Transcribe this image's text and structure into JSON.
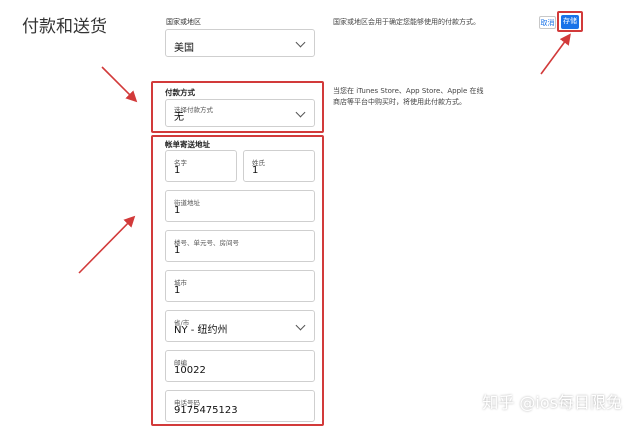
{
  "page": {
    "title": "付款和送货"
  },
  "region": {
    "label": "国家或地区",
    "value": "美国",
    "description": "国家或地区会用于确定您能够使用的付款方式。"
  },
  "payment": {
    "section_label": "付款方式",
    "select_caption": "选择付款方式",
    "select_value": "无",
    "description": "当您在 iTunes Store、App Store、Apple 在线商店等平台中购买时，将使用此付款方式。"
  },
  "billing": {
    "section_label": "帐单寄送地址",
    "first_name": {
      "caption": "名字",
      "value": "1"
    },
    "last_name": {
      "caption": "姓氏",
      "value": "1"
    },
    "street": {
      "caption": "街道地址",
      "value": "1"
    },
    "unit": {
      "caption": "楼号、单元号、房间号",
      "value": "1"
    },
    "city": {
      "caption": "城市",
      "value": "1"
    },
    "state": {
      "caption": "省/市",
      "value": "NY - 纽约州"
    },
    "zip": {
      "caption": "邮编",
      "value": "10022"
    },
    "phone": {
      "caption": "电话号码",
      "value": "9175475123"
    }
  },
  "actions": {
    "cancel_label": "取消",
    "save_label": "存储"
  },
  "watermark": {
    "text": "知乎 @ios每日限免"
  },
  "colors": {
    "accent": "#1a73e8",
    "highlight": "#d23a3a"
  }
}
